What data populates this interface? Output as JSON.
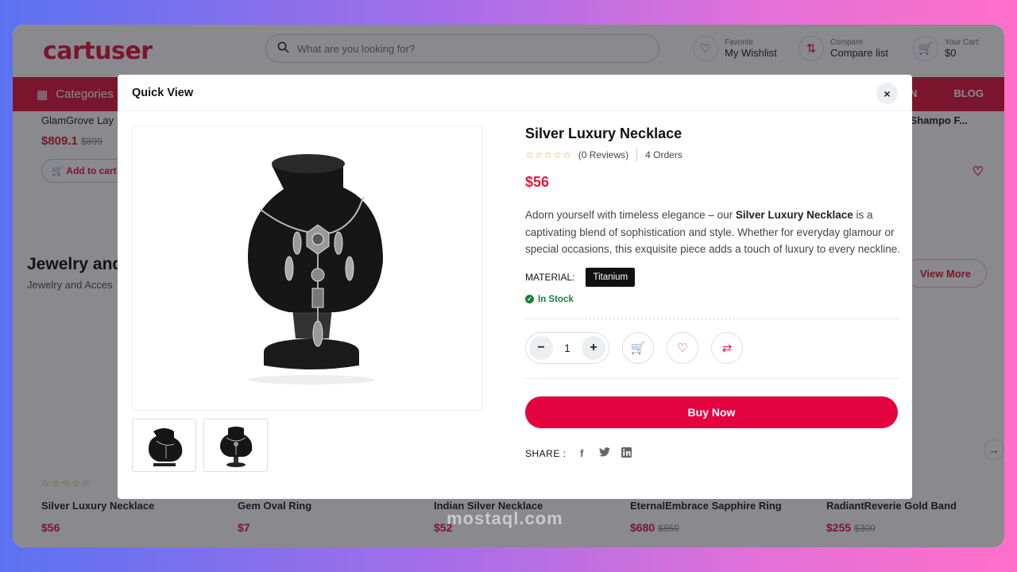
{
  "site": {
    "logo_text": "cartuser",
    "search_placeholder": "What are you looking for?",
    "favorite": {
      "small": "Favorite",
      "label": "My Wishlist"
    },
    "compare": {
      "small": "Compare",
      "label": "Compare list"
    },
    "cart": {
      "small": "Your Cart:",
      "label": "$0"
    },
    "nav": {
      "categories": "Categories",
      "right_items": [
        "IGN",
        "BLOG"
      ]
    },
    "top_card": {
      "name": "GlamGrove Lay",
      "price": "$809.1",
      "old_price": "$899",
      "add_label": "Add to cart"
    },
    "top_right_name": "n Shampo F...",
    "section": {
      "title": "Jewelry and",
      "subtitle": "Jewelry and Acces",
      "view_more": "View More"
    },
    "products": [
      {
        "name": "Silver Luxury Necklace",
        "price": "$56",
        "old_price": ""
      },
      {
        "name": "Gem Oval Ring",
        "price": "$7",
        "old_price": ""
      },
      {
        "name": "Indian Silver Necklace",
        "price": "$52",
        "old_price": ""
      },
      {
        "name": "EternalEmbrace Sapphire Ring",
        "price": "$680",
        "old_price": "$850"
      },
      {
        "name": "RadiantReverie Gold Band",
        "price": "$255",
        "old_price": "$300"
      }
    ]
  },
  "modal": {
    "title": "Quick View",
    "close": "×",
    "product": {
      "name": "Silver Luxury Necklace",
      "reviews": "(0 Reviews)",
      "orders": "4 Orders",
      "price": "$56",
      "desc_pre": "Adorn yourself with timeless elegance – our ",
      "desc_bold": "Silver Luxury Necklace",
      "desc_post": " is a captivating blend of sophistication and style. Whether for everyday glamour or special occasions, this exquisite piece adds a touch of luxury to every neckline.",
      "material_label": "MATERIAL:",
      "material_value": "Titanium",
      "stock": "In Stock",
      "quantity": "1",
      "buy_label": "Buy Now",
      "share_label": "SHARE :"
    }
  },
  "watermark": "mostaql.com",
  "colors": {
    "accent": "#e3163f",
    "buy": "#e3033f",
    "stock": "#1a7f37"
  }
}
